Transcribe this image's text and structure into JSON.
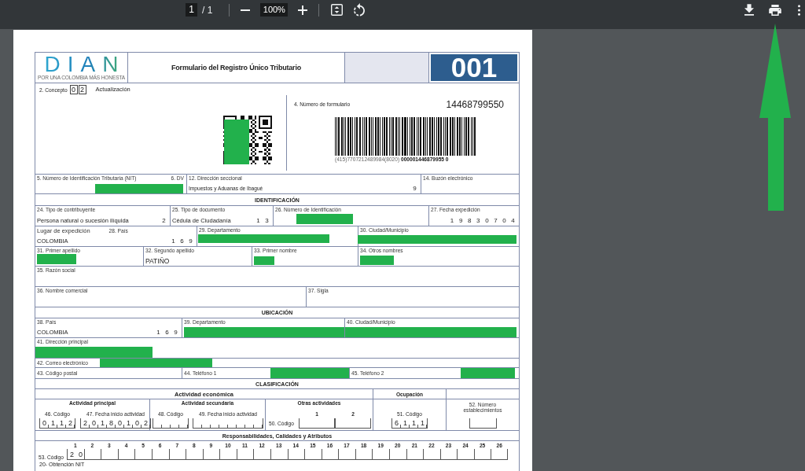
{
  "toolbar": {
    "page_number": "1",
    "page_total": "/ 1",
    "zoom": "100%"
  },
  "form": {
    "logo": {
      "wordmark": "DIAN",
      "tagline": "POR UNA COLOMBIA MÁS HONESTA"
    },
    "title": "Formulario del Registro Único Tributario",
    "form_code": "001",
    "concept": {
      "label": "2. Concepto",
      "digits": [
        "0",
        "2"
      ],
      "value": "Actualización"
    },
    "qr_code": {
      "redacted": true
    },
    "form_number": {
      "label": "4. Número de formulario",
      "value": "14468799550",
      "barcode_text": "(415)7707212489984(8020) **000001446879955 0**"
    },
    "rows": [
      {
        "kind": "fields",
        "cells": [
          {
            "label": "5. Número de Identificación Tributaria (NIT)",
            "label_2": "6. DV",
            "redacted": true
          },
          {
            "label": "12. Dirección seccional",
            "value": "Impuestos y Aduanas de Ibagué",
            "code": "9",
            "redacted": false
          },
          {
            "label": "14. Buzón electrónico",
            "redacted": false
          }
        ]
      },
      {
        "kind": "section",
        "title": "IDENTIFICACIÓN"
      },
      {
        "kind": "fields",
        "cells": [
          {
            "label": "24. Tipo de contribuyente",
            "value": "Persona natural o sucesión ilíquida",
            "code": "2",
            "redacted": false
          },
          {
            "label": "25. Tipo de documento",
            "value": "Cédula de Ciudadanía",
            "code": "1 3",
            "redacted": false
          },
          {
            "label": "26. Número de Identificación",
            "redacted": true
          },
          {
            "label": "27. Fecha expedición",
            "code": "1 9 8 3 0 7 0 4",
            "redacted": false
          }
        ]
      },
      {
        "kind": "fields",
        "cells": [
          {
            "label": "Lugar de expedición",
            "label_2": "28. País",
            "value": "COLOMBIA",
            "code": "1 6 9",
            "redacted": false
          },
          {
            "label": "29. Departamento",
            "redacted": true
          },
          {
            "label": "30. Ciudad/Municipio",
            "redacted": true
          }
        ]
      },
      {
        "kind": "fields",
        "cells": [
          {
            "label": "31. Primer apellido",
            "redacted": true
          },
          {
            "label": "32. Segundo apellido",
            "value": "PATIÑO",
            "redacted": false
          },
          {
            "label": "33. Primer nombre",
            "redacted": true
          },
          {
            "label": "34. Otros nombres",
            "redacted": true
          }
        ]
      },
      {
        "kind": "fields",
        "cells": [
          {
            "label": "35. Razón social",
            "redacted": false
          }
        ]
      },
      {
        "kind": "fields",
        "cells": [
          {
            "label": "36. Nombre comercial",
            "redacted": false
          },
          {
            "label": "37. Sigla",
            "redacted": false
          }
        ]
      },
      {
        "kind": "section",
        "title": "UBICACIÓN"
      },
      {
        "kind": "fields",
        "cells": [
          {
            "label": "38. País",
            "value": "COLOMBIA",
            "code": "1 6 9",
            "redacted": false
          },
          {
            "label": "39. Departamento",
            "redacted": true
          },
          {
            "label": "40. Ciudad/Municipio",
            "redacted": true
          }
        ]
      },
      {
        "kind": "fields",
        "cells": [
          {
            "label": "41. Dirección principal",
            "redacted": true
          }
        ]
      },
      {
        "kind": "fields",
        "cells": [
          {
            "label": "42. Correo electrónico",
            "redacted": true
          }
        ]
      },
      {
        "kind": "fields",
        "cells": [
          {
            "label": "43. Código postal",
            "redacted": false
          },
          {
            "label": "44. Teléfono 1",
            "redacted": true
          },
          {
            "label": "45. Teléfono 2",
            "redacted": true
          }
        ]
      },
      {
        "kind": "section",
        "title": "CLASIFICACIÓN"
      }
    ],
    "classification": {
      "economic_activity": {
        "title": "Actividad económica",
        "principal": {
          "title": "Actividad principal",
          "fields": [
            {
              "label": "46. Código",
              "value": "0 1 1 2"
            },
            {
              "label": "47. Fecha inicio actividad",
              "value": "2 0 1 8 0 1 0 2"
            }
          ]
        },
        "secondary": {
          "title": "Actividad secundaria",
          "fields": [
            {
              "label": "48. Código"
            },
            {
              "label": "49. Fecha inicio actividad"
            }
          ]
        },
        "other": {
          "title": "Otras actividades",
          "label": "50. Código",
          "columns": [
            "1",
            "2"
          ]
        }
      },
      "occupation": {
        "title": "Ocupación",
        "label": "51. Código",
        "value": "6 1 1 1"
      },
      "establishments": {
        "label": "52. Número establecimientos"
      }
    },
    "responsibilities": {
      "title": "Responsabilidades, Calidades y Atributos",
      "label": "53. Código",
      "columns": [
        "1",
        "2",
        "3",
        "4",
        "5",
        "6",
        "7",
        "8",
        "9",
        "10",
        "11",
        "12",
        "13",
        "14",
        "15",
        "16",
        "17",
        "18",
        "19",
        "20",
        "21",
        "22",
        "23",
        "24",
        "25",
        "26"
      ],
      "codes": [
        "2 0"
      ],
      "note": "20- Obtención NIT"
    }
  }
}
